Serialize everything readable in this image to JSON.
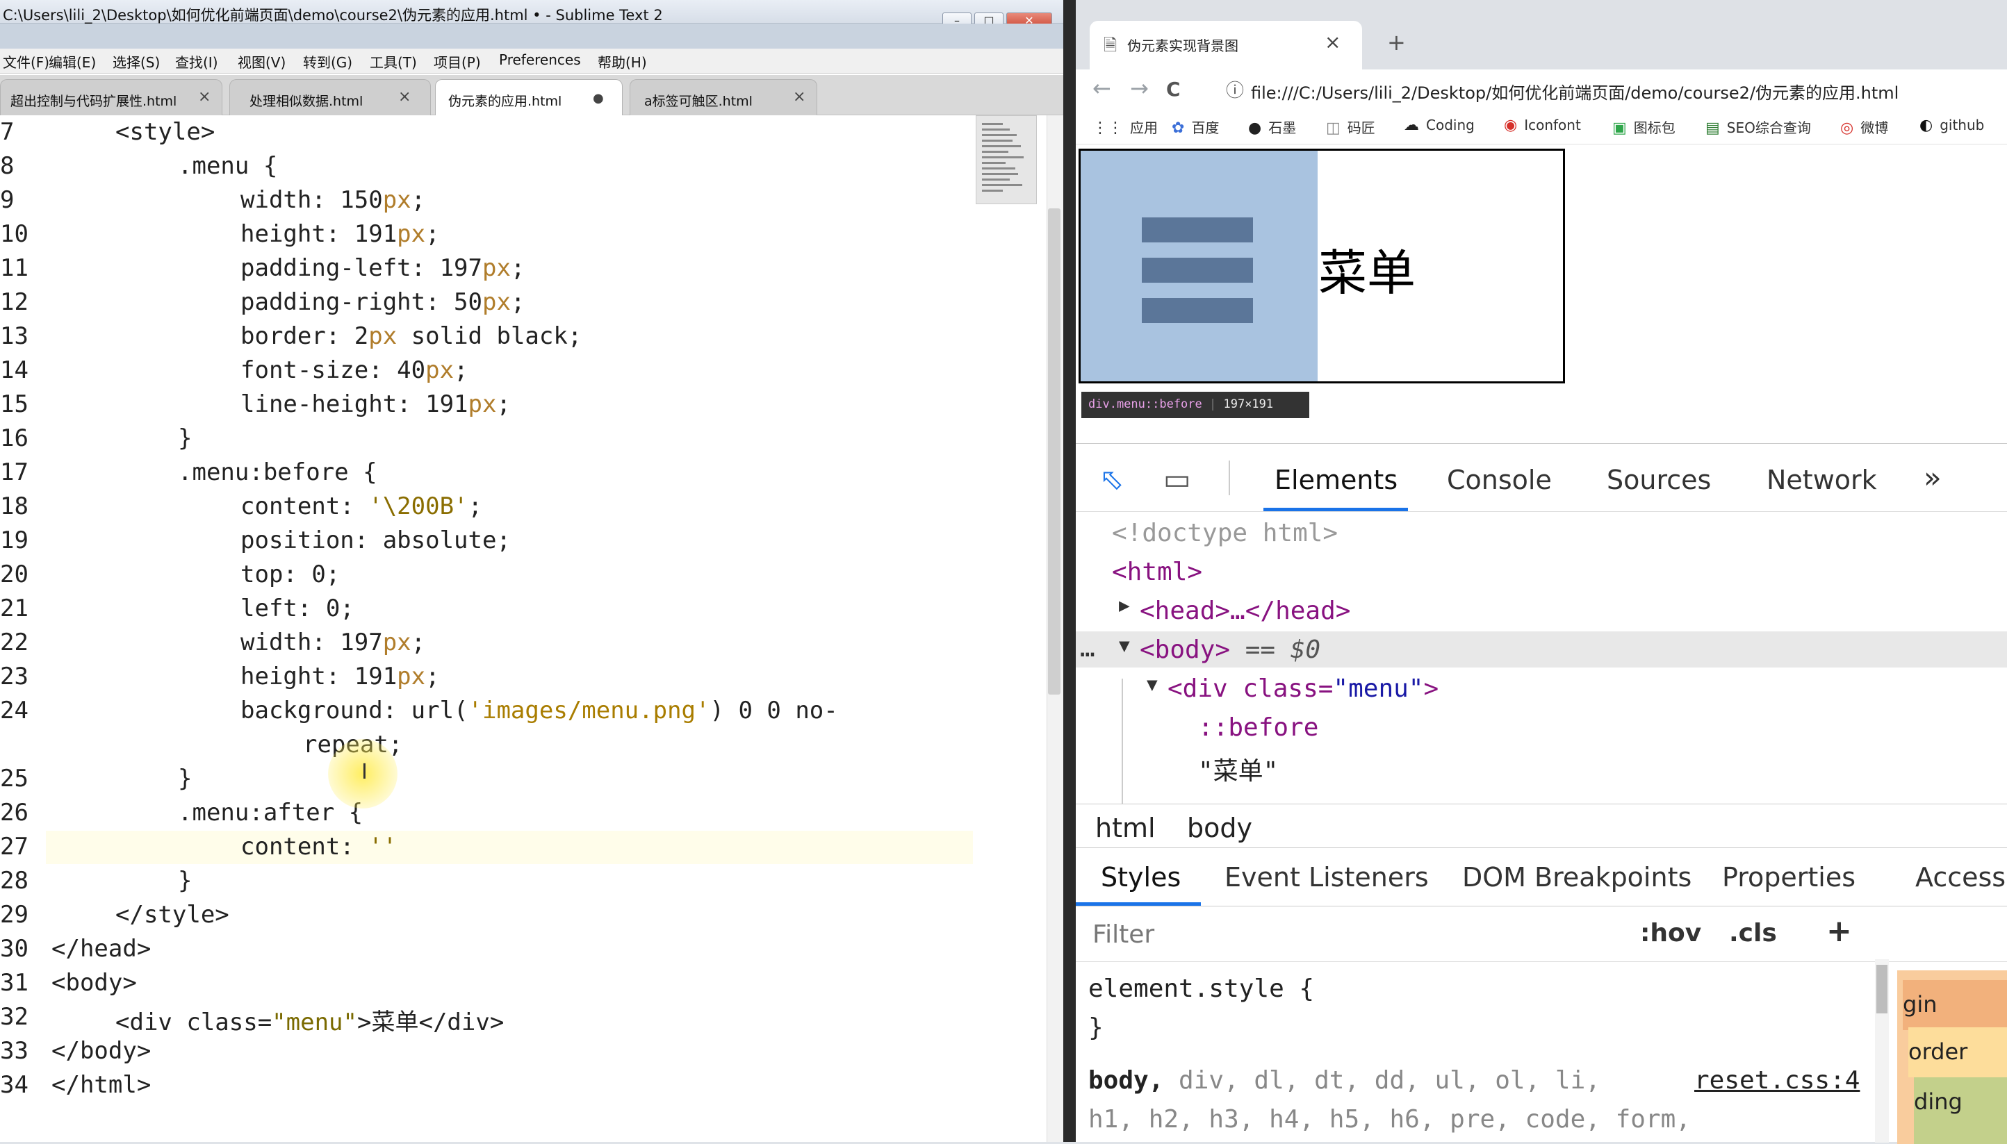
{
  "sublime": {
    "title": "C:\\Users\\lili_2\\Desktop\\如何优化前端页面\\demo\\course2\\伪元素的应用.html • - Sublime Text 2",
    "window_buttons": [
      "–",
      "□",
      "✕"
    ],
    "menu": [
      "文件(F)",
      "编辑(E)",
      "选择(S)",
      "查找(I)",
      "视图(V)",
      "转到(G)",
      "工具(T)",
      "项目(P)",
      "Preferences",
      "帮助(H)"
    ],
    "tabs": [
      {
        "label": "超出控制与代码扩展性.html",
        "close": "×"
      },
      {
        "label": "处理相似数据.html",
        "close": "×"
      },
      {
        "label": "伪元素的应用.html",
        "close": "●"
      },
      {
        "label": "a标签可触区.html",
        "close": "×"
      }
    ],
    "line_numbers": [
      "7",
      "8",
      "9",
      "10",
      "11",
      "12",
      "13",
      "14",
      "15",
      "16",
      "17",
      "18",
      "19",
      "20",
      "21",
      "22",
      "23",
      "24",
      "",
      "25",
      "26",
      "27",
      "28",
      "29",
      "30",
      "31",
      "32",
      "33",
      "34"
    ],
    "code": {
      "l7": "<style>",
      "l8": ".menu {",
      "l9a": "width: 150",
      "l9b": "px",
      "l9c": ";",
      "l10a": "height: 191",
      "l10b": "px",
      "l10c": ";",
      "l11a": "padding-left: 197",
      "l11b": "px",
      "l11c": ";",
      "l12a": "padding-right: 50",
      "l12b": "px",
      "l12c": ";",
      "l13a": "border: 2",
      "l13b": "px",
      "l13c": " solid black;",
      "l14a": "font-size: 40",
      "l14b": "px",
      "l14c": ";",
      "l15a": "line-height: 191",
      "l15b": "px",
      "l15c": ";",
      "l16": "}",
      "l17": ".menu:before {",
      "l18a": "content: ",
      "l18b": "'\\200B'",
      "l18c": ";",
      "l19": "position: absolute;",
      "l20": "top: 0;",
      "l21": "left: 0;",
      "l22a": "width: 197",
      "l22b": "px",
      "l22c": ";",
      "l23a": "height: 191",
      "l23b": "px",
      "l23c": ";",
      "l24a": "background: url(",
      "l24b": "'images/menu.png'",
      "l24c": ") 0 0 no-",
      "l24d": "repeat;",
      "l25": "}",
      "l26": ".menu:after {",
      "l27a": "content: ",
      "l27b": "''",
      "l28": "}",
      "l29": "</style>",
      "l30": "</head>",
      "l31": "<body>",
      "l32a": "<div class=",
      "l32b": "\"menu\"",
      "l32c": ">菜单</div>",
      "l33": "</body>",
      "l34": "</html>"
    },
    "cursor_glyph": "I"
  },
  "chrome": {
    "tab_title": "伪元素实现背景图",
    "tab_close": "×",
    "new_tab": "+",
    "nav": {
      "back": "←",
      "forward": "→",
      "reload": "C"
    },
    "url": "file:///C:/Users/lili_2/Desktop/如何优化前端页面/demo/course2/伪元素的应用.html",
    "info_icon": "ⓘ",
    "bookmarks": [
      {
        "icon": "⋮⋮",
        "label": "应用"
      },
      {
        "icon": "✿",
        "label": "百度"
      },
      {
        "icon": "●",
        "label": "石墨"
      },
      {
        "icon": "◫",
        "label": "码匠"
      },
      {
        "icon": "☁",
        "label": "Coding"
      },
      {
        "icon": "◉",
        "label": "Iconfont"
      },
      {
        "icon": "▣",
        "label": "图标包"
      },
      {
        "icon": "▤",
        "label": "SEO综合查询"
      },
      {
        "icon": "◎",
        "label": "微博"
      },
      {
        "icon": "◐",
        "label": "github"
      }
    ],
    "page": {
      "menu_text": "菜单",
      "tooltip_sel": "div.menu::before",
      "tooltip_size": "197×191"
    }
  },
  "devtools": {
    "tabs": [
      "Elements",
      "Console",
      "Sources",
      "Network",
      "»"
    ],
    "dom": {
      "doctype": "<!doctype html>",
      "html_open": "<html>",
      "head": "<head>…</head>",
      "body": "<body>",
      "body_eq": " == $0",
      "div_open": "<div class=",
      "div_class": "\"menu\"",
      "div_close": ">",
      "before": "::before",
      "text": "\"菜单\""
    },
    "breadcrumb": [
      "html",
      "body"
    ],
    "subtabs": [
      "Styles",
      "Event Listeners",
      "DOM Breakpoints",
      "Properties",
      "Accessi"
    ],
    "filter_placeholder": "Filter",
    "hov": ":hov",
    "cls": ".cls",
    "plus": "+",
    "rules": {
      "element_style": "element.style {",
      "close": "}",
      "body_sel_a": "body, ",
      "body_sel_b": "div, dl, dt, dd, ul, ol, li,",
      "source": "reset.css:4",
      "body_sel_c": "h1, h2, h3, h4, h5, h6, pre, code, form,"
    },
    "boxmodel": [
      "gin",
      "order",
      "ding"
    ]
  }
}
